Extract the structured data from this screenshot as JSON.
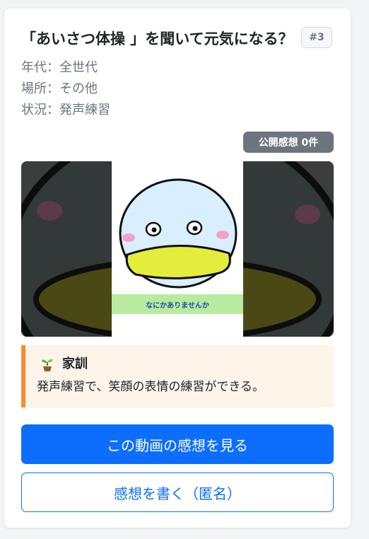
{
  "card": {
    "title": "「あいさつ体操 」を聞いて元気になる？",
    "number_badge": "#3",
    "meta": [
      "年代：全世代",
      "場所：その他",
      "状況：発声練習"
    ],
    "review_badge": "公開感想 0件"
  },
  "video": {
    "caption": "なにかありませんか",
    "colors": {
      "face": "#d9eefe",
      "mouth": "#e4ed3c",
      "cheek": "#f3a0c6",
      "caption_bg": "#b8eaa0"
    }
  },
  "motto": {
    "icon": "seedling-icon",
    "title": "家訓",
    "text": "発声練習で、笑顔の表情の練習ができる。"
  },
  "buttons": {
    "view_reviews": "この動画の感想を見る",
    "write_review": "感想を書く（匿名）"
  },
  "colors": {
    "primary": "#0d6efd",
    "badge_gray": "#6c757d",
    "motto_border": "#fd8a2f",
    "motto_bg": "#fff4ea"
  }
}
